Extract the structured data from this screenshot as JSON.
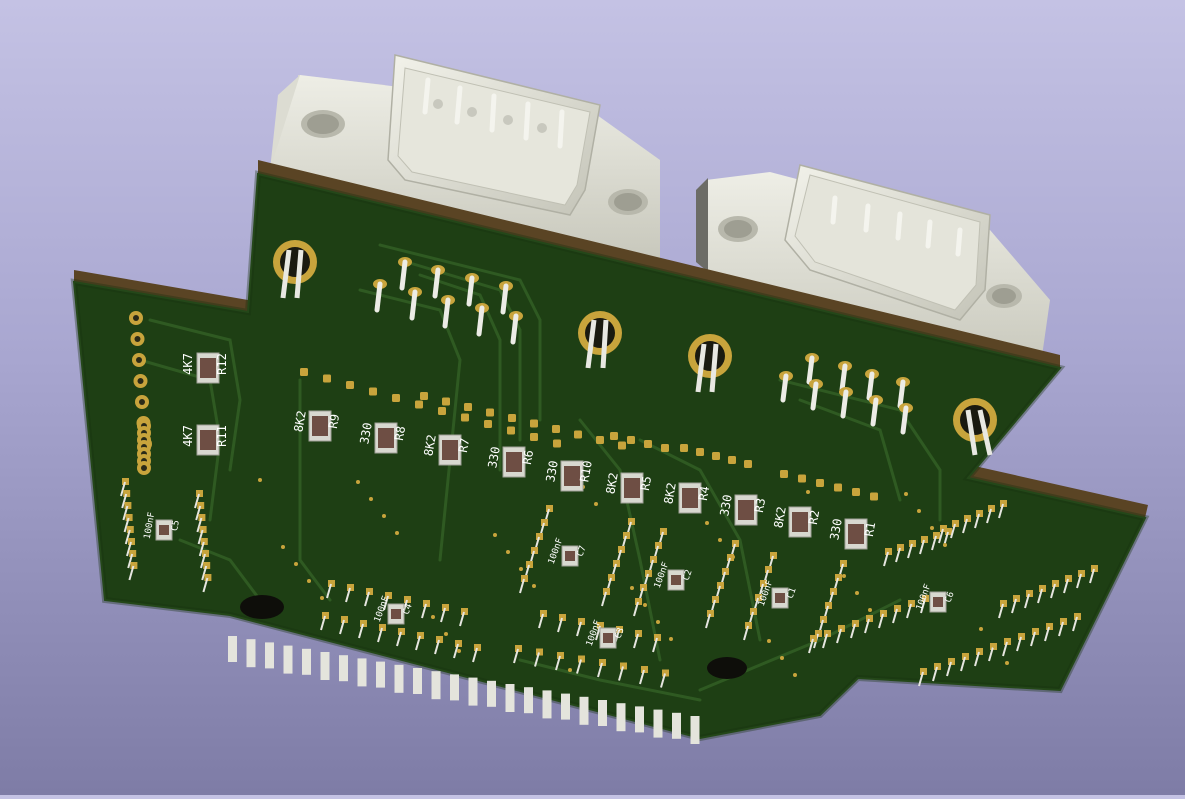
{
  "viewer": {
    "background_top": "#c4c2e4",
    "background_bottom": "#7e7ca6"
  },
  "board": {
    "solder_mask_color": "#1e3f14",
    "substrate_edge_color": "#5a4424",
    "pad_color": "#c8a43c",
    "connector_color": "#dcdcd2",
    "component_labels": [
      {
        "ref": "R12",
        "value": "4K7"
      },
      {
        "ref": "R11",
        "value": "4K7"
      },
      {
        "ref": "R9",
        "value": "8K2"
      },
      {
        "ref": "R8",
        "value": "330"
      },
      {
        "ref": "R7",
        "value": "8K2"
      },
      {
        "ref": "R6",
        "value": "330"
      },
      {
        "ref": "R10",
        "value": "330"
      },
      {
        "ref": "R5",
        "value": "8K2"
      },
      {
        "ref": "R4",
        "value": "8K2"
      },
      {
        "ref": "R3",
        "value": "330"
      },
      {
        "ref": "R2",
        "value": "8K2"
      },
      {
        "ref": "R1",
        "value": "330"
      },
      {
        "ref": "C5",
        "value": "100nF"
      },
      {
        "ref": "C4",
        "value": "100nF"
      },
      {
        "ref": "C3",
        "value": "100nF"
      },
      {
        "ref": "C2",
        "value": "100nF"
      },
      {
        "ref": "C1",
        "value": "100nF"
      },
      {
        "ref": "C6",
        "value": "100nF"
      },
      {
        "ref": "C7",
        "value": "100nF"
      }
    ]
  }
}
